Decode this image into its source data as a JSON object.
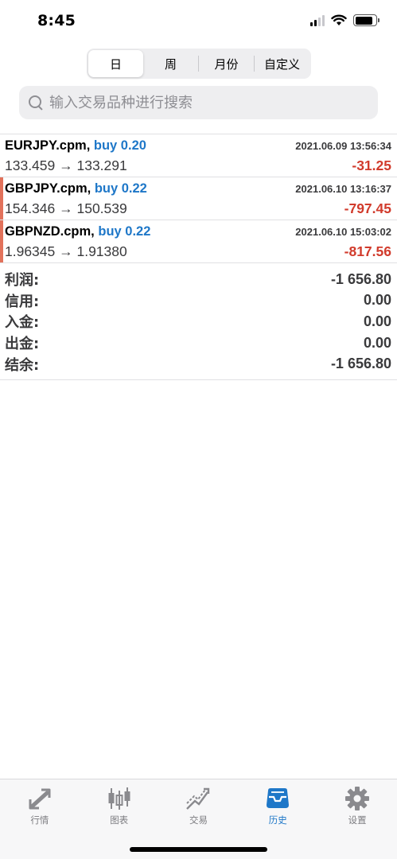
{
  "status_bar": {
    "time": "8:45"
  },
  "period_tabs": [
    "日",
    "周",
    "月份",
    "自定义"
  ],
  "active_period": "日",
  "search": {
    "placeholder": "输入交易品种进行搜索",
    "value": ""
  },
  "trades": [
    {
      "symbol": "EURJPY.cpm,",
      "side": "buy 0.20",
      "time": "2021.06.09 13:56:34",
      "prices": "133.459 → 133.291",
      "profit": "-31.25"
    },
    {
      "symbol": "GBPJPY.cpm,",
      "side": "buy 0.22",
      "time": "2021.06.10 13:16:37",
      "prices": "154.346 → 150.539",
      "profit": "-797.45"
    },
    {
      "symbol": "GBPNZD.cpm,",
      "side": "buy 0.22",
      "time": "2021.06.10 15:03:02",
      "prices": "1.96345 → 1.91380",
      "profit": "-817.56"
    }
  ],
  "summary": [
    {
      "label": "利润:",
      "value": "-1 656.80"
    },
    {
      "label": "信用:",
      "value": "0.00"
    },
    {
      "label": "入金:",
      "value": "0.00"
    },
    {
      "label": "出金:",
      "value": "0.00"
    },
    {
      "label": "结余:",
      "value": "-1 656.80"
    }
  ],
  "tabbar": [
    {
      "label": "行情",
      "icon": "quotes-icon"
    },
    {
      "label": "图表",
      "icon": "chart-candles-icon"
    },
    {
      "label": "交易",
      "icon": "trade-icon"
    },
    {
      "label": "历史",
      "icon": "history-icon",
      "active": true
    },
    {
      "label": "设置",
      "icon": "settings-gear-icon"
    }
  ],
  "colors": {
    "accent": "#1e77c8",
    "loss": "#d13b2c",
    "loss_bar": "#e2725b"
  }
}
